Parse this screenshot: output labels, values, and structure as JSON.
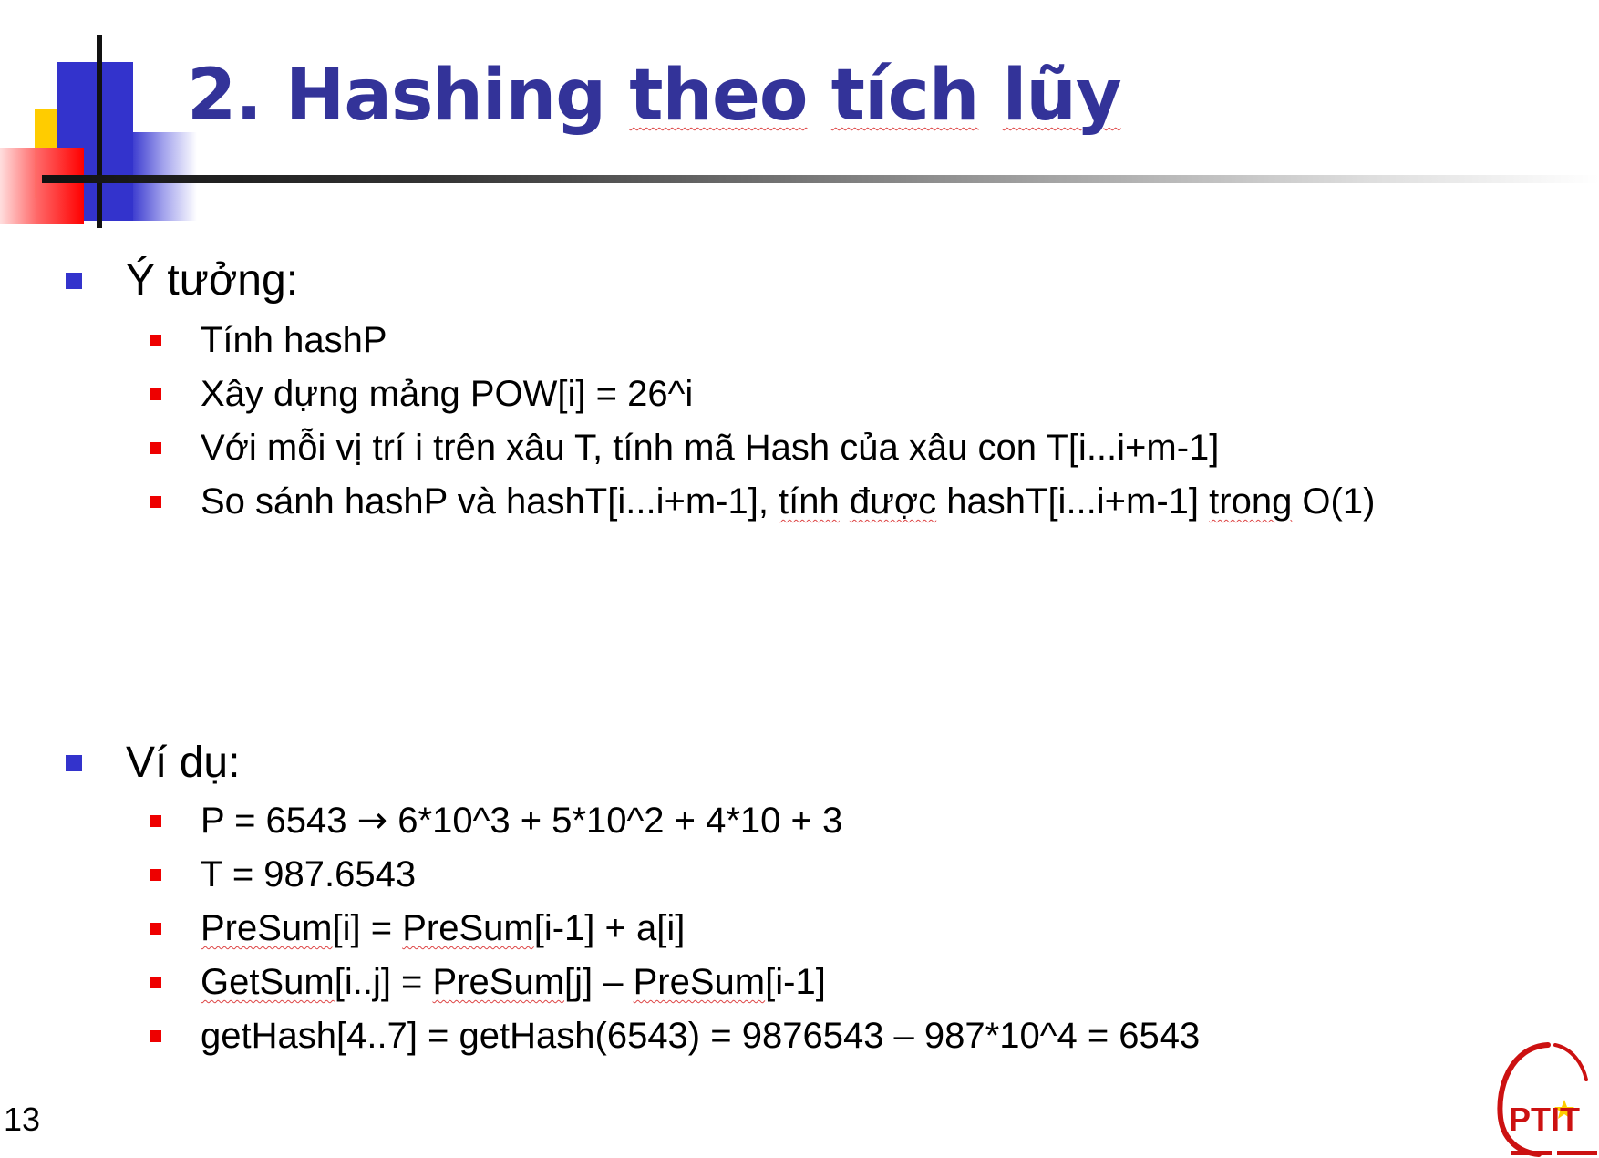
{
  "slide": {
    "title_parts": [
      "2. Hashing ",
      "theo",
      " ",
      "tích",
      " ",
      "lũy"
    ],
    "slide_number": "13",
    "logo_text": "PTIT"
  },
  "sections": [
    {
      "heading": "Ý tưởng:",
      "items": [
        [
          "Tính hashP"
        ],
        [
          "Xây dựng mảng POW[i] = 26^i"
        ],
        [
          "Với mỗi vị trí i trên xâu T, tính mã Hash của xâu con T[i...i+m-1]"
        ],
        [
          "So sánh hashP và hashT[i...i+m-1], ",
          "tính",
          " ",
          "được",
          " hashT[i...i+m-1] ",
          "trong",
          " O(1)"
        ]
      ]
    },
    {
      "heading": "Ví dụ:",
      "items": [
        [
          "P = 6543 ",
          "→",
          " 6*10^3 + 5*10^2 + 4*10 + 3"
        ],
        [
          "T = 987.6543"
        ],
        [
          "PreSum",
          "[i] = ",
          "PreSum",
          "[i-1] + a[i]"
        ],
        [
          "GetSum",
          "[i..j] = ",
          "PreSum",
          "[j] – ",
          "PreSum",
          "[i-1]"
        ],
        [
          "getHash[4..7] = getHash(6543) = 9876543 – 987*10^4 = 6543"
        ]
      ]
    }
  ],
  "colors": {
    "title": "#333399",
    "level1_bullet": "#3333cc",
    "level2_bullet": "#ee0000",
    "accent_yellow": "#ffcc00",
    "accent_red": "#ff0000"
  }
}
